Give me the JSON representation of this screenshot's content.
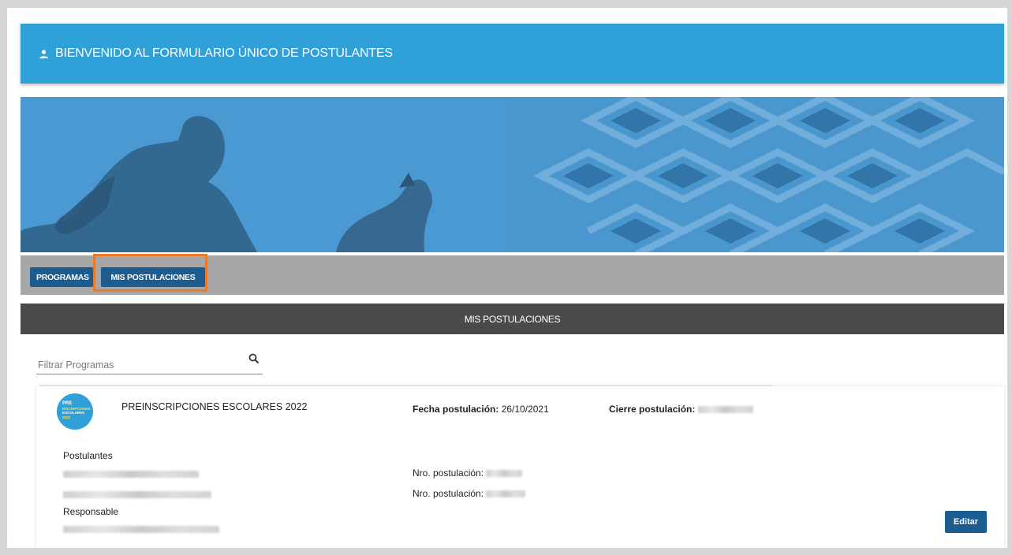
{
  "header": {
    "title": "BIENVENIDO AL FORMULARIO ÚNICO DE POSTULANTES",
    "icon": "user-icon",
    "color": "#2fa0d8"
  },
  "banner": {
    "tint": "#3b8fcc"
  },
  "tabs": [
    {
      "label": "PROGRAMAS"
    },
    {
      "label": "MIS POSTULACIONES",
      "highlighted": true
    }
  ],
  "section": {
    "title": "MIS POSTULACIONES"
  },
  "filter": {
    "placeholder": "Filtrar Programas",
    "value": "",
    "icon": "search-icon"
  },
  "card": {
    "logo": {
      "line1": "PRE",
      "line2": "INSCRIPCIONES",
      "line3": "ESCOLARES",
      "line4": "2022"
    },
    "program_title": "PREINSCRIPCIONES ESCOLARES 2022",
    "fecha_label": "Fecha postulación:",
    "fecha_value": "26/10/2021",
    "cierre_label": "Cierre postulación:",
    "postulantes_label": "Postulantes",
    "nro_label": "Nro. postulación:",
    "responsable_label": "Responsable",
    "edit_label": "Editar"
  },
  "colors": {
    "primary_button": "#1d5c8f",
    "highlight": "#ea7a2a",
    "section_bar": "#4a4a4a",
    "tab_bar": "#a7a7a7"
  }
}
